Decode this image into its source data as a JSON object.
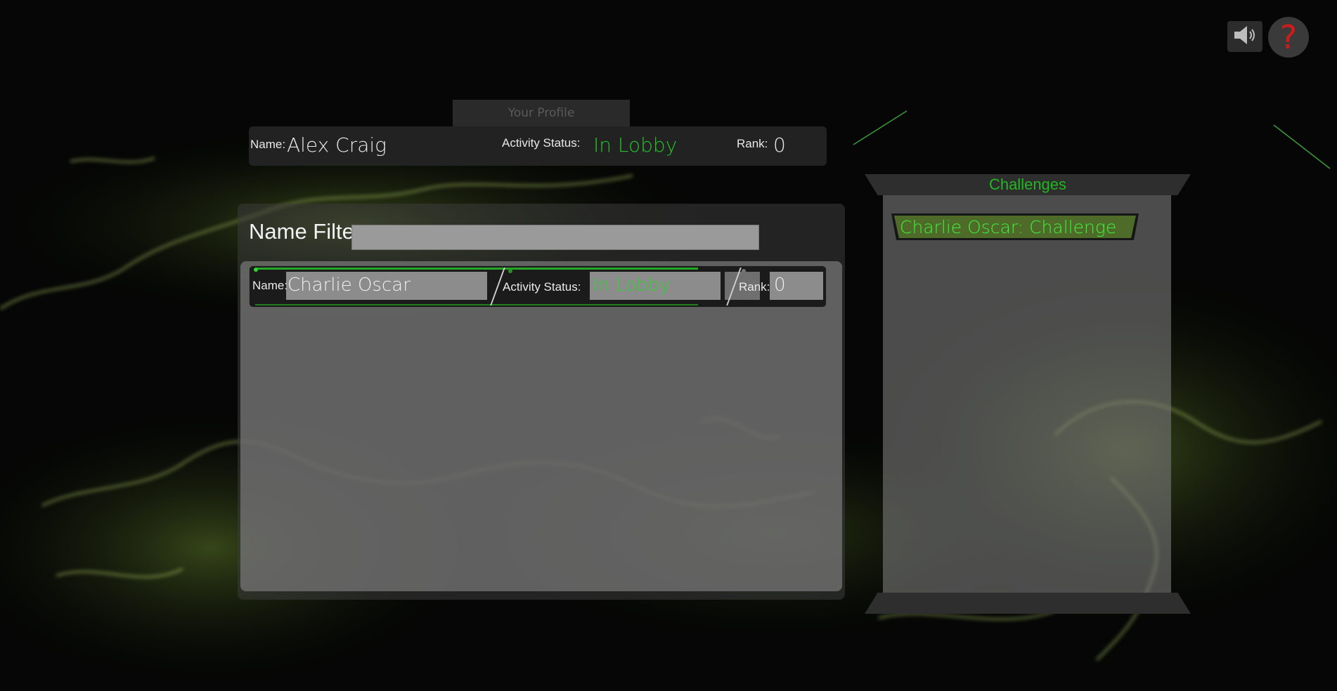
{
  "controls": {
    "sound_icon": "speaker-icon",
    "help_icon": "question-mark-icon",
    "help_glyph": "?"
  },
  "profile": {
    "tab_label": "Your Profile",
    "name_label": "Name:",
    "name_value": "Alex Craig",
    "status_label": "Activity Status:",
    "status_value": "In Lobby",
    "rank_label": "Rank:",
    "rank_value": "0"
  },
  "filter": {
    "label": "Name Filter:",
    "value": ""
  },
  "players": [
    {
      "name_label": "Name:",
      "name": "Charlie Oscar",
      "status_label": "Activity Status:",
      "status": "In Lobby",
      "rank_label": "Rank:",
      "rank": "0"
    }
  ],
  "challenges": {
    "title": "Challenges",
    "items": [
      {
        "label": "Charlie Oscar: Challenge"
      }
    ]
  },
  "colors": {
    "accent_green": "#27c227",
    "help_red": "#d11a1a",
    "background": "#050605"
  }
}
